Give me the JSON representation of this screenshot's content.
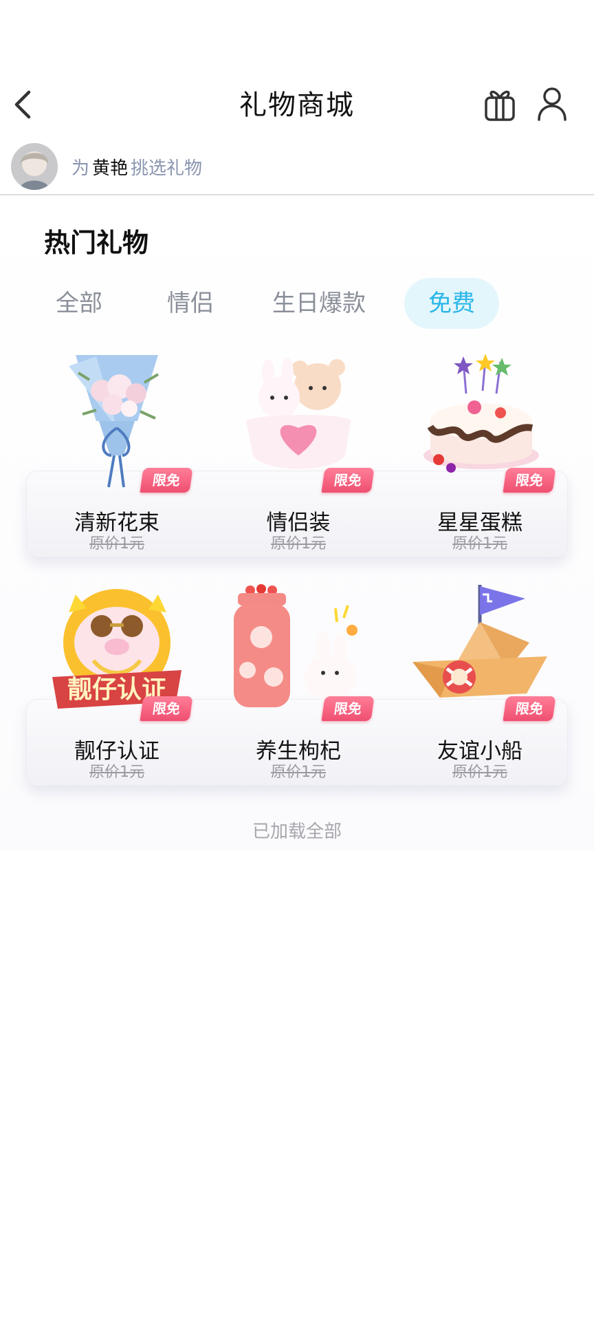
{
  "header": {
    "title": "礼物商城"
  },
  "recipient": {
    "prefix": "为",
    "name": "黄艳",
    "suffix": "挑选礼物"
  },
  "section": {
    "title": "热门礼物"
  },
  "tabs": [
    {
      "label": "全部"
    },
    {
      "label": "情侣"
    },
    {
      "label": "生日爆款"
    },
    {
      "label": "免费",
      "active": true
    }
  ],
  "gifts": [
    {
      "name": "清新花束",
      "badge": "限免",
      "price": "原价1元",
      "icon": "bouquet-icon"
    },
    {
      "name": "情侣装",
      "badge": "限免",
      "price": "原价1元",
      "icon": "couple-bears-icon"
    },
    {
      "name": "星星蛋糕",
      "badge": "限免",
      "price": "原价1元",
      "icon": "star-cake-icon"
    },
    {
      "name": "靓仔认证",
      "badge": "限免",
      "price": "原价1元",
      "icon": "cool-pig-icon"
    },
    {
      "name": "养生枸杞",
      "badge": "限免",
      "price": "原价1元",
      "icon": "thermos-icon"
    },
    {
      "name": "友谊小船",
      "badge": "限免",
      "price": "原价1元",
      "icon": "paper-boat-icon"
    }
  ],
  "footer": {
    "load_all": "已加载全部"
  },
  "colors": {
    "accent": "#29b6e8",
    "tab_active_bg": "#e3f6fc",
    "badge": "#ef4f70",
    "muted": "#8a94b0"
  }
}
